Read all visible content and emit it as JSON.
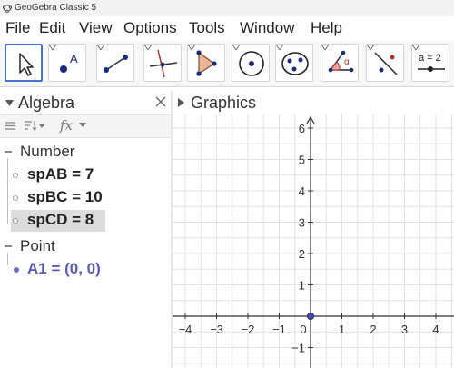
{
  "window": {
    "title": "GeoGebra Classic 5"
  },
  "menu": {
    "items": [
      "File",
      "Edit",
      "View",
      "Options",
      "Tools",
      "Window",
      "Help"
    ]
  },
  "toolbar": {
    "tools": [
      {
        "icon": "move-arrow-icon",
        "selected": true
      },
      {
        "icon": "point-icon",
        "label": "A"
      },
      {
        "icon": "segment-icon"
      },
      {
        "icon": "perpendicular-line-icon"
      },
      {
        "icon": "polygon-icon"
      },
      {
        "icon": "circle-with-center-icon"
      },
      {
        "icon": "ellipse-icon"
      },
      {
        "icon": "angle-icon",
        "label": "α"
      },
      {
        "icon": "reflect-about-line-icon"
      },
      {
        "icon": "slider-icon",
        "label": "a = 2"
      }
    ]
  },
  "algebra": {
    "title": "Algebra",
    "toolbar_fx": "fx",
    "groups": [
      {
        "name": "Number",
        "items": [
          {
            "text": "spAB = 7",
            "selected": false
          },
          {
            "text": "spBC = 10",
            "selected": false
          },
          {
            "text": "spCD = 8",
            "selected": true
          }
        ]
      },
      {
        "name": "Point",
        "items": [
          {
            "text": "A1 = (0, 0)",
            "selected": false
          }
        ]
      }
    ]
  },
  "graphics": {
    "title": "Graphics",
    "x_ticks": [
      "−4",
      "−3",
      "−2",
      "−1",
      "0",
      "1",
      "2",
      "3",
      "4"
    ],
    "y_ticks": [
      "6",
      "5",
      "4",
      "3",
      "2",
      "1",
      "−1"
    ],
    "points": [
      {
        "name": "A1",
        "x": 0,
        "y": 0,
        "color": "#4a4ab8"
      }
    ]
  },
  "colors": {
    "selection_border": "#4a6fd0",
    "point_color": "#5a5ab8"
  }
}
